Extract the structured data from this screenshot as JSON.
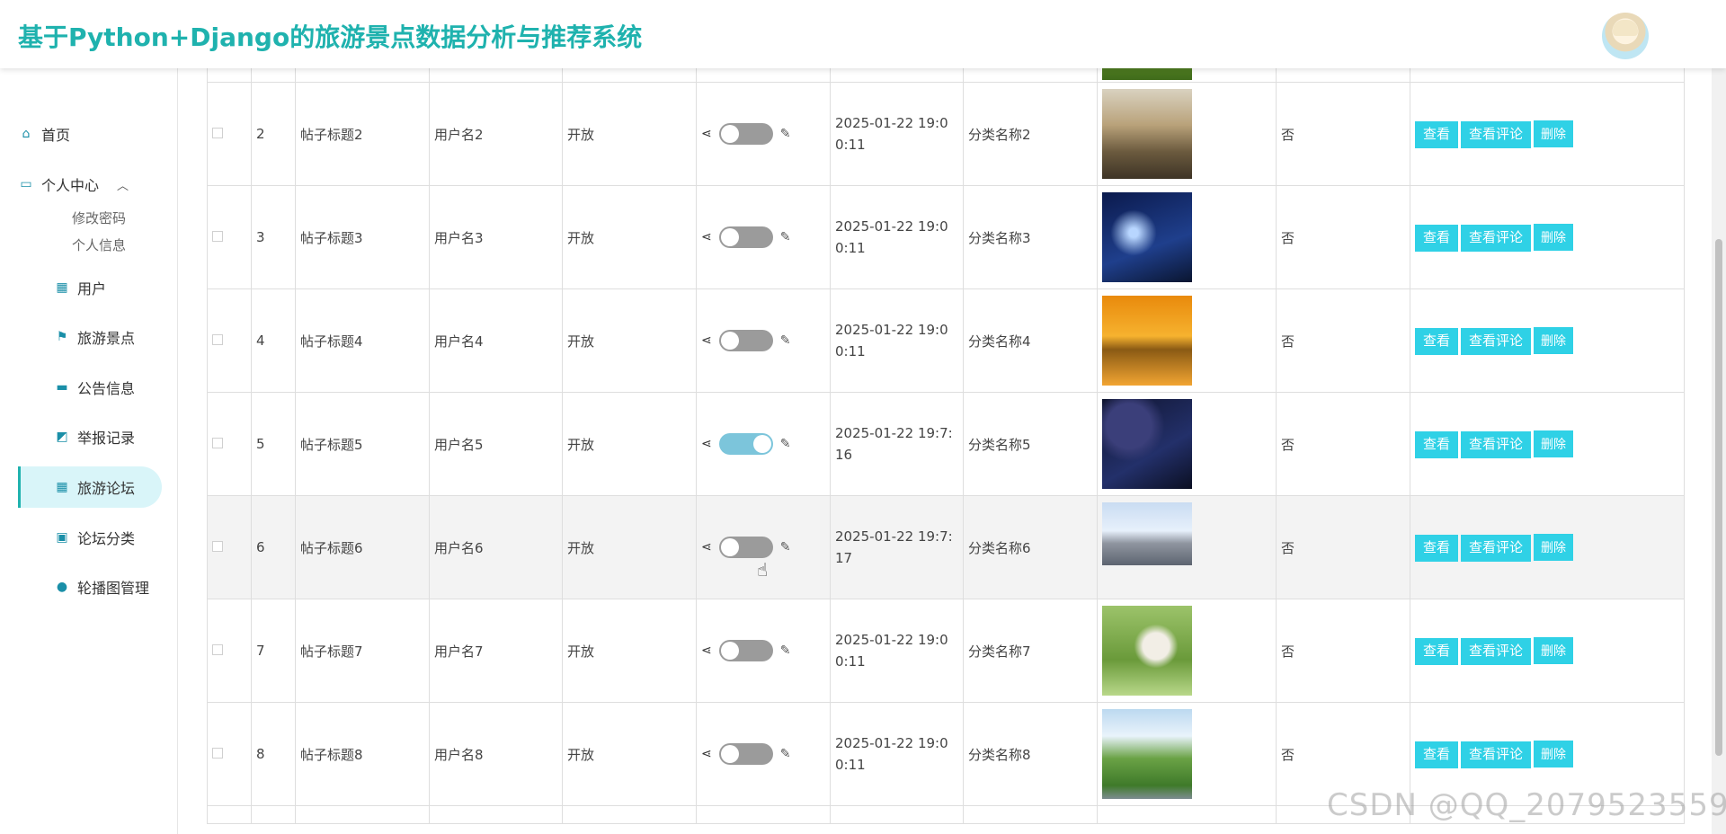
{
  "header": {
    "title": "基于Python+Django的旅游景点数据分析与推荐系统"
  },
  "sidebar": {
    "items": [
      {
        "label": "首页",
        "icon": "home-icon"
      },
      {
        "label": "个人中心",
        "icon": "wallet-icon",
        "expanded": true,
        "children": [
          "修改密码",
          "个人信息"
        ]
      },
      {
        "label": "用户",
        "icon": "grid-icon"
      },
      {
        "label": "旅游景点",
        "icon": "flag-icon"
      },
      {
        "label": "公告信息",
        "icon": "monitor-icon"
      },
      {
        "label": "举报记录",
        "icon": "tag-icon"
      },
      {
        "label": "旅游论坛",
        "icon": "grid-icon",
        "active": true
      },
      {
        "label": "论坛分类",
        "icon": "briefcase-icon"
      },
      {
        "label": "轮播图管理",
        "icon": "pin-icon"
      }
    ]
  },
  "table": {
    "rows": [
      {
        "num": "2",
        "title": "帖子标题2",
        "user": "用户名2",
        "status": "开放",
        "toggle_on": false,
        "time": "2025-01-22 19:00:11",
        "category": "分类名称2",
        "image_name": "hikers-sunset-photo",
        "flag": "否"
      },
      {
        "num": "3",
        "title": "帖子标题3",
        "user": "用户名3",
        "status": "开放",
        "toggle_on": false,
        "time": "2025-01-22 19:00:11",
        "category": "分类名称3",
        "image_name": "starry-night-girl-photo",
        "flag": "否"
      },
      {
        "num": "4",
        "title": "帖子标题4",
        "user": "用户名4",
        "status": "开放",
        "toggle_on": false,
        "time": "2025-01-22 19:00:11",
        "category": "分类名称4",
        "image_name": "lake-sunset-photo",
        "flag": "否"
      },
      {
        "num": "5",
        "title": "帖子标题5",
        "user": "用户名5",
        "status": "开放",
        "toggle_on": true,
        "time": "2025-01-22 19:7:16",
        "category": "分类名称5",
        "image_name": "space-planet-photo",
        "flag": "否"
      },
      {
        "num": "6",
        "title": "帖子标题6",
        "user": "用户名6",
        "status": "开放",
        "toggle_on": false,
        "time": "2025-01-22 19:7:17",
        "category": "分类名称6",
        "image_name": "campus-blossom-photo",
        "flag": "否"
      },
      {
        "num": "7",
        "title": "帖子标题7",
        "user": "用户名7",
        "status": "开放",
        "toggle_on": false,
        "time": "2025-01-22 19:00:11",
        "category": "分类名称7",
        "image_name": "girl-paper-plane-photo",
        "flag": "否"
      },
      {
        "num": "8",
        "title": "帖子标题8",
        "user": "用户名8",
        "status": "开放",
        "toggle_on": false,
        "time": "2025-01-22 19:00:11",
        "category": "分类名称8",
        "image_name": "meadow-stream-photo",
        "flag": "否"
      }
    ],
    "actions": {
      "view": "查看",
      "view_comments": "查看评论",
      "delete": "删除"
    }
  },
  "watermark": "CSDN @QQ_2079523559",
  "colors": {
    "accent": "#1fb2ae",
    "button": "#2fd1e6",
    "toggle_on": "#7cc5db",
    "toggle_off": "#9b9b9b"
  }
}
